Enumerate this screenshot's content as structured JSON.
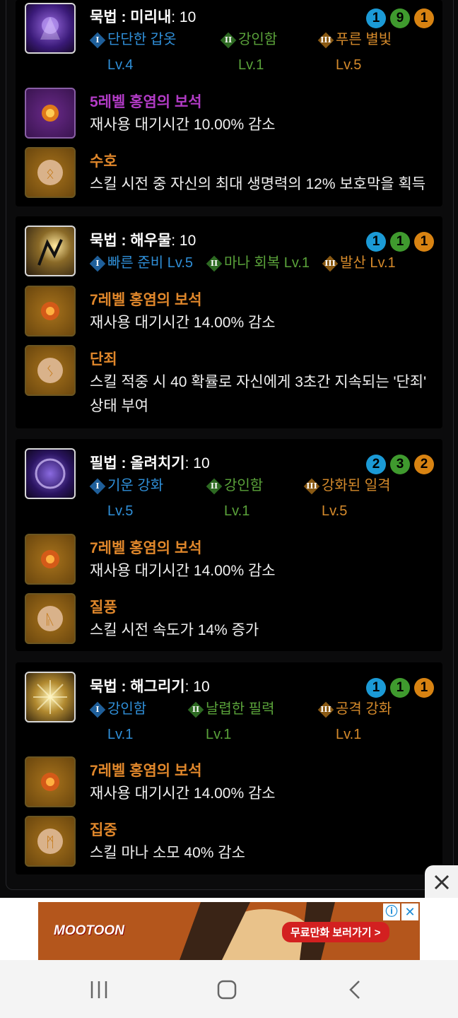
{
  "cards": [
    {
      "title": "묵법 : 미리내",
      "level": ": 10",
      "tri_levels": [
        "1",
        "9",
        "1"
      ],
      "tri": [
        {
          "mark": "I",
          "name": "단단한 갑옷",
          "lvl": "Lv.4"
        },
        {
          "mark": "II",
          "name": "강인함",
          "lvl": "Lv.1"
        },
        {
          "mark": "III",
          "name": "푸른 별빛",
          "lvl": "Lv.5"
        }
      ],
      "gem_name": "5레벨 홍염의 보석",
      "gem_desc": "재사용 대기시간 10.00% 감소",
      "rune_name": "수호",
      "rune_desc": [
        "스킬 시전 중 자신의 최대 생명력의 12% 보호막을 획득"
      ]
    },
    {
      "title": "묵법 : 해우물",
      "level": ": 10",
      "tri_levels": [
        "1",
        "1",
        "1"
      ],
      "tri": [
        {
          "mark": "I",
          "name": "빠른 준비 Lv.5",
          "lvl": ""
        },
        {
          "mark": "II",
          "name": "마나 회복 Lv.1",
          "lvl": ""
        },
        {
          "mark": "III",
          "name": "발산 Lv.1",
          "lvl": ""
        }
      ],
      "gem_name": "7레벨 홍염의 보석",
      "gem_desc": "재사용 대기시간 14.00% 감소",
      "rune_name": "단죄",
      "rune_desc": [
        "스킬 적중 시 40 확률로 자신에게 3초간 지속되는 '단죄'",
        "상태 부여"
      ]
    },
    {
      "title": "필법 : 올려치기",
      "level": ": 10",
      "tri_levels": [
        "2",
        "3",
        "2"
      ],
      "tri": [
        {
          "mark": "I",
          "name": "기운 강화",
          "lvl": "Lv.5"
        },
        {
          "mark": "II",
          "name": "강인함",
          "lvl": "Lv.1"
        },
        {
          "mark": "III",
          "name": "강화된 일격",
          "lvl": "Lv.5"
        }
      ],
      "gem_name": "7레벨 홍염의 보석",
      "gem_desc": "재사용 대기시간 14.00% 감소",
      "rune_name": "질풍",
      "rune_desc": [
        "스킬 시전 속도가 14% 증가"
      ]
    },
    {
      "title": "묵법 : 해그리기",
      "level": ": 10",
      "tri_levels": [
        "1",
        "1",
        "1"
      ],
      "tri": [
        {
          "mark": "I",
          "name": "강인함",
          "lvl": "Lv.1"
        },
        {
          "mark": "II",
          "name": "날렵한 필력",
          "lvl": "Lv.1"
        },
        {
          "mark": "III",
          "name": "공격 강화",
          "lvl": "Lv.1"
        }
      ],
      "gem_name": "7레벨 홍염의 보석",
      "gem_desc": "재사용 대기시간 14.00% 감소",
      "rune_name": "집중",
      "rune_desc": [
        "스킬 마나 소모 40% 감소"
      ]
    }
  ],
  "ad": {
    "brand": "MOOTOON",
    "cta": "무료만화 보러가기 >"
  },
  "nav": {
    "recent": "recent-apps",
    "home": "home",
    "back": "back"
  }
}
